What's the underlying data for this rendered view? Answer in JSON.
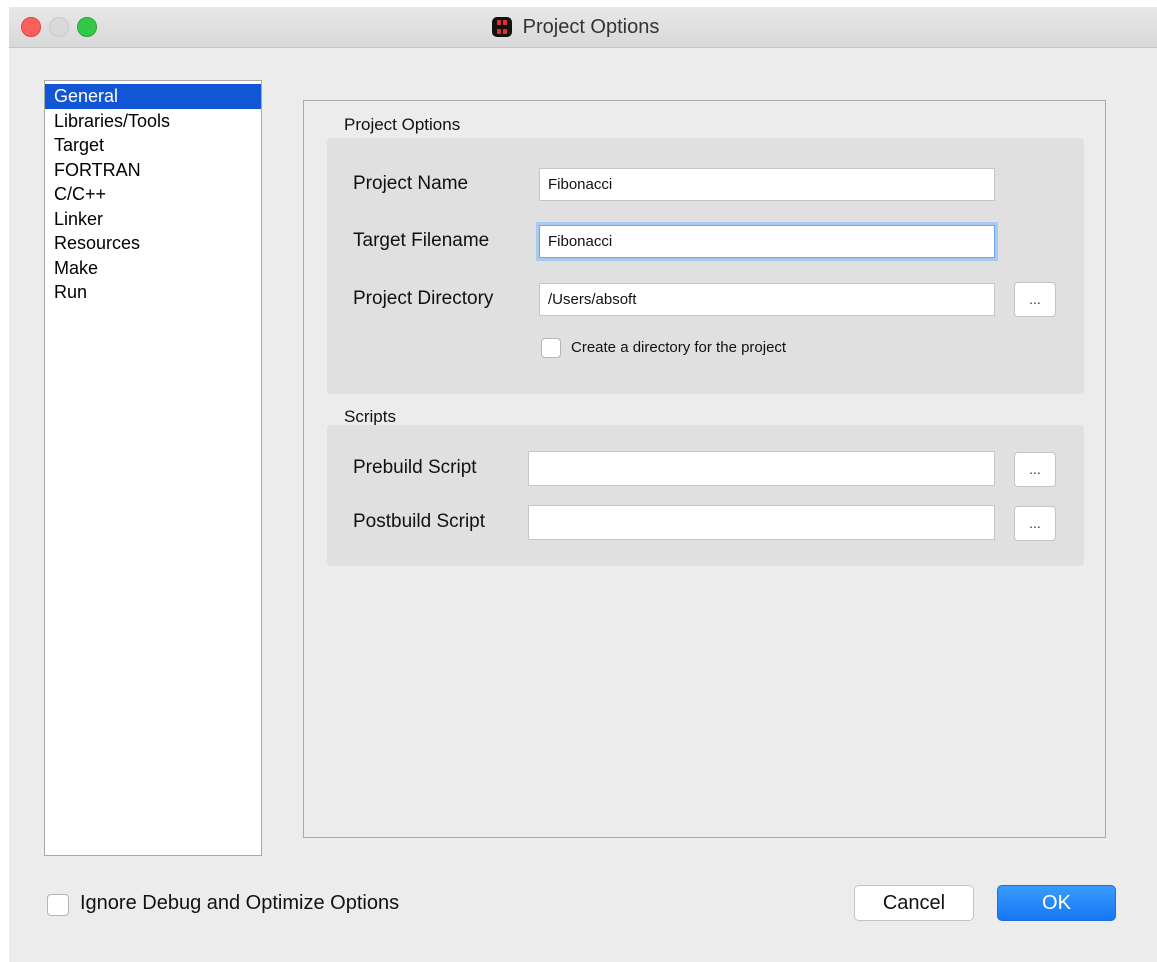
{
  "window": {
    "title": "Project Options"
  },
  "sidebar": {
    "items": [
      {
        "label": "General",
        "selected": true
      },
      {
        "label": "Libraries/Tools",
        "selected": false
      },
      {
        "label": "Target",
        "selected": false
      },
      {
        "label": "FORTRAN",
        "selected": false
      },
      {
        "label": "C/C++",
        "selected": false
      },
      {
        "label": "Linker",
        "selected": false
      },
      {
        "label": "Resources",
        "selected": false
      },
      {
        "label": "Make",
        "selected": false
      },
      {
        "label": "Run",
        "selected": false
      }
    ]
  },
  "project_options": {
    "group_title": "Project Options",
    "project_name_label": "Project Name",
    "project_name_value": "Fibonacci",
    "target_filename_label": "Target Filename",
    "target_filename_value": "Fibonacci",
    "project_directory_label": "Project Directory",
    "project_directory_value": "/Users/absoft",
    "browse_label": "...",
    "create_directory_label": "Create a directory for the project",
    "create_directory_checked": false
  },
  "scripts": {
    "group_title": "Scripts",
    "prebuild_label": "Prebuild Script",
    "prebuild_value": "",
    "postbuild_label": "Postbuild Script",
    "postbuild_value": "",
    "browse_label": "..."
  },
  "footer": {
    "ignore_debug_label": "Ignore Debug and Optimize Options",
    "ignore_debug_checked": false,
    "cancel_label": "Cancel",
    "ok_label": "OK"
  },
  "colors": {
    "selection": "#1156d6",
    "ok_button": "#1577f5",
    "close": "#fc605c",
    "maximize": "#34c84a"
  }
}
